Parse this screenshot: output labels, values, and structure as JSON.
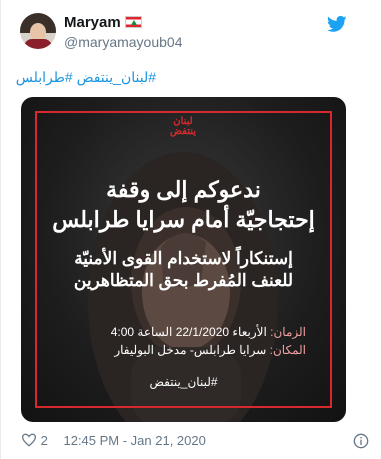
{
  "tweet": {
    "author_name": "Maryam",
    "author_handle": "@maryamayoub04",
    "hashtags": "#لبنان_ينتفض #طرابلس",
    "like_count": "2",
    "timestamp": "12:45 PM - Jan 21, 2020"
  },
  "poster": {
    "logo_line1": "لبنان",
    "logo_line2": "ينتفض",
    "headline_line1": "ندعوكم إلى وقفة",
    "headline_line2": "إحتجاجيّة أمام سرايا طرابلس",
    "sub_line1": "إستنكاراً لاستخدام القوى الأمنيّة",
    "sub_line2": "للعنف المُفرط بحق المتظاهرين",
    "time_label": "الزمان:",
    "time_value": "الأربعاء 22/1/2020 الساعة 4:00",
    "place_label": "المكان:",
    "place_value": "سرايا طرابلس- مدخل البوليفار",
    "hashtag": "#لبنان_ينتفض"
  },
  "colors": {
    "accent": "#1b95e0",
    "poster_red": "#d7282f",
    "muted": "#657786"
  },
  "icons": {
    "platform": "twitter-bird-icon",
    "flag": "lebanon-flag-icon",
    "like": "heart-icon",
    "info": "info-icon"
  }
}
